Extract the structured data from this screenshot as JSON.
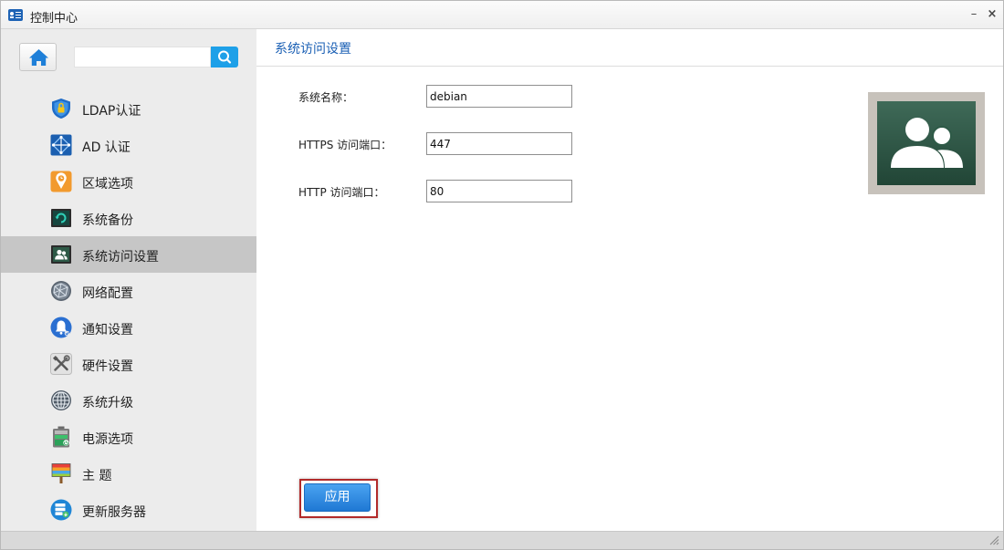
{
  "window": {
    "title": "控制中心",
    "minimize_glyph": "–",
    "close_glyph": "×"
  },
  "sidebar": {
    "search": {
      "value": "",
      "placeholder": ""
    },
    "items": [
      {
        "label": "LDAP认证",
        "icon": "ldap-shield-icon"
      },
      {
        "label": "AD 认证",
        "icon": "ad-network-icon"
      },
      {
        "label": "区域选项",
        "icon": "region-clock-icon"
      },
      {
        "label": "系统备份",
        "icon": "backup-icon"
      },
      {
        "label": "系统访问设置",
        "icon": "users-access-icon",
        "active": true
      },
      {
        "label": "网络配置",
        "icon": "network-globe-icon"
      },
      {
        "label": "通知设置",
        "icon": "bell-icon"
      },
      {
        "label": "硬件设置",
        "icon": "tools-icon"
      },
      {
        "label": "系统升级",
        "icon": "upgrade-globe-icon"
      },
      {
        "label": "电源选项",
        "icon": "battery-icon"
      },
      {
        "label": "主 题",
        "icon": "theme-brush-icon"
      },
      {
        "label": "更新服务器",
        "icon": "update-server-icon"
      }
    ]
  },
  "content": {
    "title": "系统访问设置",
    "fields": {
      "system_name": {
        "label": "系统名称：",
        "value": "debian"
      },
      "https_port": {
        "label": "HTTPS 访问端口：",
        "value": "447"
      },
      "http_port": {
        "label": "HTTP 访问端口：",
        "value": "80"
      }
    },
    "apply_label": "应用"
  },
  "colors": {
    "accent": "#1ea0e8",
    "title_blue": "#1a5fb4",
    "active_item_bg": "#c6c6c6",
    "sidebar_bg": "#ececec",
    "highlight_border": "#b22a2a",
    "avatar_bg": "#2e5a47"
  }
}
